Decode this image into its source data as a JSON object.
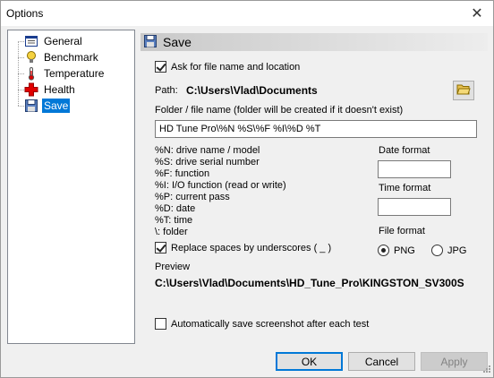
{
  "window": {
    "title": "Options",
    "close_glyph": "✕"
  },
  "tree": {
    "items": [
      {
        "label": "General",
        "icon": "general-icon"
      },
      {
        "label": "Benchmark",
        "icon": "benchmark-icon"
      },
      {
        "label": "Temperature",
        "icon": "thermometer-icon"
      },
      {
        "label": "Health",
        "icon": "health-cross-icon"
      },
      {
        "label": "Save",
        "icon": "floppy-disk-icon",
        "selected": true
      }
    ]
  },
  "panel": {
    "header": "Save",
    "ask_filename": {
      "label": "Ask for file name and location",
      "checked": true
    },
    "path_label": "Path:",
    "path_value": "C:\\Users\\Vlad\\Documents",
    "folder_label": "Folder / file name (folder will be created if it doesn't exist)",
    "folder_value": "HD Tune Pro\\%N %S\\%F %I\\%D %T",
    "legend": [
      "%N: drive name / model",
      "%S: drive serial number",
      "%F: function",
      "%I: I/O function (read or write)",
      "%P: current pass",
      "%D: date",
      "%T: time",
      "\\: folder"
    ],
    "date_format_label": "Date format",
    "date_format_value": "",
    "time_format_label": "Time format",
    "time_format_value": "",
    "file_format_label": "File format",
    "file_format_options": [
      {
        "label": "PNG",
        "checked": true
      },
      {
        "label": "JPG",
        "checked": false
      }
    ],
    "replace_spaces": {
      "label": "Replace spaces by underscores ( _ )",
      "checked": true
    },
    "preview_label": "Preview",
    "preview_value": "C:\\Users\\Vlad\\Documents\\HD_Tune_Pro\\KINGSTON_SV300S",
    "auto_save": {
      "label": "Automatically save screenshot after each test",
      "checked": false
    }
  },
  "buttons": {
    "ok": "OK",
    "cancel": "Cancel",
    "apply": "Apply"
  },
  "colors": {
    "selection": "#0078d7",
    "health_red": "#e00000",
    "folder_yellow": "#e8c050"
  }
}
